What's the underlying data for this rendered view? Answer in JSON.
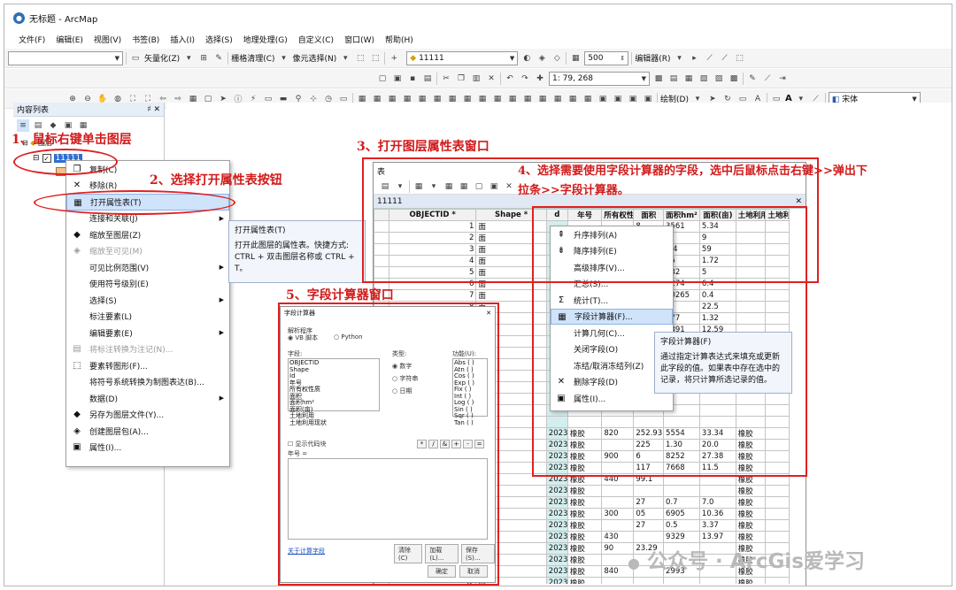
{
  "app": {
    "title": "无标题 - ArcMap",
    "title_icon": "arcmap-globe-icon"
  },
  "menus": [
    "文件(F)",
    "编辑(E)",
    "视图(V)",
    "书签(B)",
    "插入(I)",
    "选择(S)",
    "地理处理(G)",
    "自定义(C)",
    "窗口(W)",
    "帮助(H)"
  ],
  "toolbar": {
    "vectorize": "矢量化(Z)",
    "raster_clean": "栅格清理(C)",
    "pixel_select": "像元选择(N)",
    "layer_combo": "11111",
    "scale_combo": "500",
    "editor": "编辑器(R)",
    "coord_combo": "1: 79, 268",
    "draw": "绘制(D)",
    "font": "宋体",
    "A": "A"
  },
  "toc": {
    "title": "内容列表",
    "pin": "♯",
    "close": "✕",
    "group_label": "图层",
    "layer_name": "11111"
  },
  "context_menu": [
    {
      "label": "复制(C)",
      "icon": "copy-icon",
      "disabled": false,
      "sub": false
    },
    {
      "label": "移除(R)",
      "icon": "remove-icon",
      "disabled": false,
      "sub": false
    },
    {
      "label": "打开属性表(T)",
      "icon": "table-icon",
      "disabled": false,
      "sub": false,
      "highlight": true
    },
    {
      "label": "连接和关联(J)",
      "icon": "",
      "disabled": false,
      "sub": true
    },
    {
      "label": "缩放至图层(Z)",
      "icon": "zoom-layer-icon",
      "disabled": false,
      "sub": false
    },
    {
      "label": "缩放至可见(M)",
      "icon": "zoom-visible-icon",
      "disabled": true,
      "sub": false
    },
    {
      "label": "可见比例范围(V)",
      "icon": "",
      "disabled": false,
      "sub": true
    },
    {
      "label": "使用符号级别(E)",
      "icon": "",
      "disabled": false,
      "sub": false
    },
    {
      "label": "选择(S)",
      "icon": "",
      "disabled": false,
      "sub": true
    },
    {
      "label": "标注要素(L)",
      "icon": "",
      "disabled": false,
      "sub": false
    },
    {
      "label": "编辑要素(E)",
      "icon": "",
      "disabled": false,
      "sub": true
    },
    {
      "label": "将标注转换为注记(N)...",
      "icon": "annotation-icon",
      "disabled": true,
      "sub": false
    },
    {
      "label": "要素转图形(F)...",
      "icon": "feature-graphic-icon",
      "disabled": false,
      "sub": false
    },
    {
      "label": "将符号系统转换为制图表达(B)...",
      "icon": "",
      "disabled": false,
      "sub": false
    },
    {
      "label": "数据(D)",
      "icon": "",
      "disabled": false,
      "sub": true
    },
    {
      "label": "另存为图层文件(Y)...",
      "icon": "layer-file-icon",
      "disabled": false,
      "sub": false
    },
    {
      "label": "创建图层包(A)...",
      "icon": "layer-package-icon",
      "disabled": false,
      "sub": false
    },
    {
      "label": "属性(I)...",
      "icon": "properties-icon",
      "disabled": false,
      "sub": false
    }
  ],
  "tooltip_open_table": {
    "title": "打开属性表(T)",
    "body": "打开此图层的属性表。快捷方式: CTRL + 双击图层名称或 CTRL + T。"
  },
  "table_window": {
    "title": "表",
    "tab": "11111",
    "close": "✕",
    "columns": [
      "OBJECTID *",
      "Shape *",
      "d",
      "年号",
      "所有权性质",
      "面积",
      "面积hm²",
      "面积(亩)",
      "土地利用",
      "土地利用现状"
    ],
    "rows": [
      [
        "1",
        "面",
        "",
        "",
        "",
        "8",
        "3561",
        "5.34",
        ""
      ],
      [
        "2",
        "面",
        "",
        "",
        "",
        "8",
        "",
        "9",
        ""
      ],
      [
        "3",
        "面",
        "",
        "",
        "",
        "5",
        "0.4",
        "59",
        ""
      ],
      [
        "4",
        "面",
        "",
        "",
        "",
        "0",
        "15",
        "1.72",
        ""
      ],
      [
        "5",
        "面",
        "",
        "",
        "",
        "",
        "332",
        "5",
        ""
      ],
      [
        "6",
        "面",
        "",
        "",
        "",
        "",
        "4274",
        "6.4",
        ""
      ],
      [
        "7",
        "面",
        "",
        "",
        "",
        "",
        "40265",
        "0.4",
        ""
      ],
      [
        "8",
        "面",
        "",
        "",
        "",
        "",
        "",
        "22.5",
        ""
      ],
      [
        "9",
        "面",
        "",
        "",
        "",
        "04",
        "177",
        "1.32",
        ""
      ],
      [
        "10",
        "面",
        "",
        "",
        "",
        "",
        "8391",
        "12.59",
        ""
      ],
      [
        "11",
        "面",
        "",
        "",
        "",
        "",
        "",
        "",
        ""
      ],
      [
        "12",
        "面",
        "",
        "",
        "",
        "",
        "",
        "",
        ""
      ],
      [
        "13",
        "面",
        "",
        "",
        "",
        "",
        "",
        "",
        ""
      ],
      [
        "14",
        "面",
        "",
        "",
        "",
        "",
        "",
        "",
        ""
      ],
      [
        "15",
        "面",
        "",
        "",
        "",
        "",
        "",
        "",
        ""
      ],
      [
        "16",
        "面",
        "",
        "",
        "",
        "",
        "",
        "",
        ""
      ],
      [
        "17",
        "面",
        "",
        "",
        "",
        "",
        "",
        "",
        ""
      ],
      [
        "18",
        "面",
        "",
        "",
        "",
        "",
        "",
        "",
        ""
      ],
      [
        "19",
        "面",
        "2023",
        "橡胶",
        "820",
        "252.93",
        "5554",
        "33.34",
        "橡胶"
      ],
      [
        "20",
        "面",
        "2023",
        "橡胶",
        "",
        "225",
        "1.30",
        "20.0",
        "橡胶"
      ],
      [
        "21",
        "面",
        "2023",
        "橡胶",
        "900",
        "6",
        "8252",
        "27.38",
        "橡胶"
      ],
      [
        "22",
        "面",
        "2023",
        "橡胶",
        "",
        "117",
        "7668",
        "11.5",
        "橡胶"
      ],
      [
        "23",
        "面",
        "2023",
        "橡胶",
        "440",
        "99.1",
        "",
        "",
        "橡胶"
      ],
      [
        "24",
        "面",
        "2023",
        "橡胶",
        "",
        "",
        "",
        "",
        "橡胶"
      ],
      [
        "25",
        "面",
        "2023",
        "橡胶",
        "",
        "27",
        "0.7",
        "7.0",
        "橡胶"
      ],
      [
        "26",
        "面",
        "2023",
        "橡胶",
        "300",
        "05",
        "6905",
        "10.36",
        "橡胶"
      ],
      [
        "27",
        "面",
        "2023",
        "橡胶",
        "",
        "27",
        "0.5",
        "3.37",
        "橡胶"
      ],
      [
        "28",
        "面",
        "2023",
        "橡胶",
        "430",
        "",
        "9329",
        "13.97",
        "橡胶"
      ],
      [
        "29",
        "面",
        "2023",
        "橡胶",
        "90",
        "23.29",
        "",
        "",
        "橡胶"
      ],
      [
        "30",
        "面",
        "2023",
        "橡胶",
        "",
        "",
        "",
        "",
        "橡胶"
      ],
      [
        "31",
        "面",
        "2023",
        "橡胶",
        "840",
        "",
        "2993",
        "",
        "橡胶"
      ],
      [
        "32",
        "面",
        "2023",
        "橡胶",
        "",
        "",
        "",
        "",
        "橡胶"
      ]
    ]
  },
  "field_menu": [
    {
      "label": "升序排列(A)",
      "icon": "sort-asc-icon"
    },
    {
      "label": "降序排列(E)",
      "icon": "sort-desc-icon"
    },
    {
      "label": "高级排序(V)...",
      "icon": ""
    },
    {
      "label": "汇总(S)...",
      "icon": ""
    },
    {
      "label": "统计(T)...",
      "icon": "sigma-icon"
    },
    {
      "label": "字段计算器(F)...",
      "icon": "field-calc-icon",
      "highlight": true
    },
    {
      "label": "计算几何(C)...",
      "icon": ""
    },
    {
      "label": "关闭字段(O)",
      "icon": ""
    },
    {
      "label": "冻结/取消冻结列(Z)",
      "icon": ""
    },
    {
      "label": "删除字段(D)",
      "icon": "delete-icon"
    },
    {
      "label": "属性(I)...",
      "icon": "properties-icon"
    }
  ],
  "tooltip_field_calc": {
    "title": "字段计算器(F)",
    "body": "通过指定计算表达式来填充或更新此字段的值。如果表中存在选中的记录，将只计算所选记录的值。"
  },
  "field_calculator": {
    "title": "字段计算器",
    "parser_label": "解析程序",
    "vbscript": "VB 脚本",
    "python": "Python",
    "fields_label": "字段:",
    "type_label": "类型:",
    "functions_label": "功能(U):",
    "fields": [
      "OBJECTID",
      "Shape",
      "Id",
      "年号",
      "所有权性质",
      "面积",
      "面积hm²",
      "面积(亩)",
      "土地利用",
      "土地利用现状"
    ],
    "types": [
      "数字",
      "字符串",
      "日期"
    ],
    "functions": [
      "Abs ( )",
      "Atn ( )",
      "Cos ( )",
      "Exp ( )",
      "Fix ( )",
      "Int ( )",
      "Log ( )",
      "Sin ( )",
      "Sqr ( )",
      "Tan ( )"
    ],
    "code_block": "显示代码块",
    "expr_label": "年号 =",
    "ops": [
      "*",
      "/",
      "&",
      "+",
      "-",
      "="
    ],
    "help_link": "关于计算字段",
    "clear": "清除(C)",
    "load": "加载(L)...",
    "save": "保存(S)...",
    "ok": "确定",
    "cancel": "取消"
  },
  "annotations": {
    "a1": "1、鼠标右键单击图层",
    "a2": "2、选择打开属性表按钮",
    "a3": "3、打开图层属性表窗口",
    "a4": "4、选择需要使用字段计算器的字段，选中后鼠标点击右键>>弹出下拉条>>字段计算器。",
    "a5": "5、字段计算器窗口"
  },
  "watermark": "公众号 · ArcGis爱学习"
}
